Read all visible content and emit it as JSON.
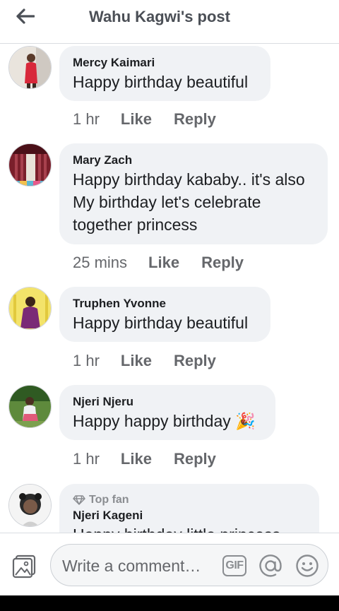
{
  "header": {
    "title": "Wahu Kagwi's post"
  },
  "comments": [
    {
      "author": "Mercy Kaimari",
      "text": "Happy birthday beautiful",
      "time": "1 hr",
      "like": "Like",
      "reply": "Reply"
    },
    {
      "author": "Mary Zach",
      "text": "Happy birthday kababy.. it's also\nMy birthday let's celebrate\ntogether princess",
      "time": "25 mins",
      "like": "Like",
      "reply": "Reply"
    },
    {
      "author": "Truphen Yvonne",
      "text": "Happy birthday beautiful",
      "time": "1 hr",
      "like": "Like",
      "reply": "Reply"
    },
    {
      "author": "Njeri Njeru",
      "text": "Happy happy birthday",
      "emoji": "🎉",
      "time": "1 hr",
      "like": "Like",
      "reply": "Reply"
    },
    {
      "badge": "Top fan",
      "author": "Njeri Kageni",
      "text": "Happy birthday little princess"
    }
  ],
  "composer": {
    "placeholder": "Write a comment…",
    "gif_label": "GIF"
  },
  "icons": {
    "back": "back-arrow-icon",
    "photo": "photo-icon",
    "gif": "gif-icon",
    "mention": "at-icon",
    "emoji": "smiley-icon",
    "badge": "diamond-icon"
  },
  "colors": {
    "bubble": "#f0f2f5",
    "meta_text": "#65676b",
    "icon_grey": "#8a8d91"
  }
}
